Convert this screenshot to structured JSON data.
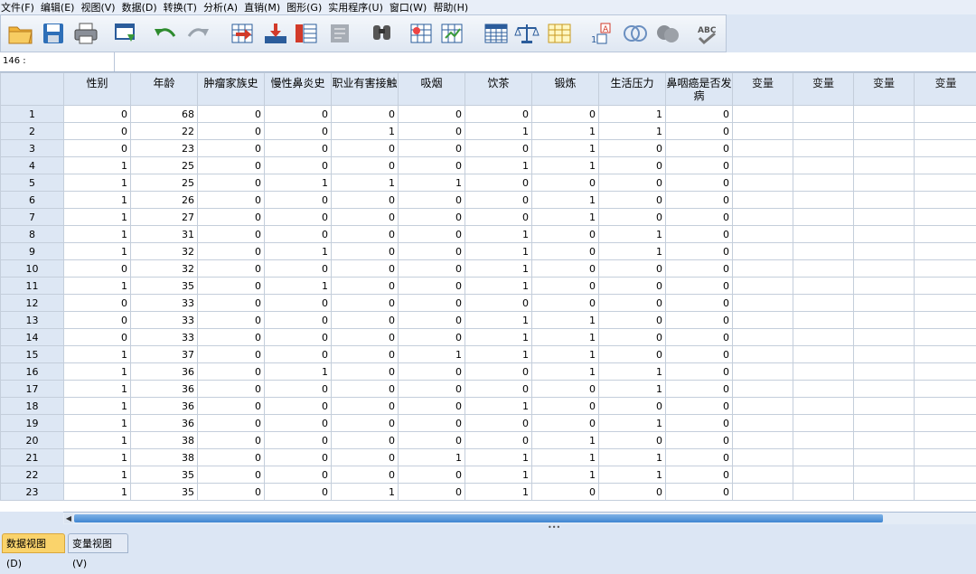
{
  "menu": [
    "文件(F)",
    "编辑(E)",
    "视图(V)",
    "数据(D)",
    "转换(T)",
    "分析(A)",
    "直销(M)",
    "图形(G)",
    "实用程序(U)",
    "窗口(W)",
    "帮助(H)"
  ],
  "toolbar_icons": [
    "open-folder-icon",
    "save-icon",
    "print-icon",
    "dialog-recall-icon",
    "undo-icon",
    "redo-icon",
    "goto-case-icon",
    "goto-variable-icon",
    "variables-icon",
    "run-descriptive-icon",
    "find-icon",
    "insert-cases-icon",
    "insert-variable-icon",
    "split-file-icon",
    "weight-cases-icon",
    "select-cases-icon",
    "value-labels-icon",
    "use-sets-icon",
    "show-all-variables-icon",
    "spell-check-icon"
  ],
  "cell_ref": "146 :",
  "columns": [
    "性别",
    "年龄",
    "肿瘤家族史",
    "慢性鼻炎史",
    "职业有害接触",
    "吸烟",
    "饮茶",
    "锻炼",
    "生活压力",
    "鼻咽癌是否发病"
  ],
  "empty_columns": [
    "变量",
    "变量",
    "变量",
    "变量"
  ],
  "rows": [
    [
      "1",
      "0",
      "68",
      "0",
      "0",
      "0",
      "0",
      "0",
      "0",
      "1",
      "0"
    ],
    [
      "2",
      "0",
      "22",
      "0",
      "0",
      "1",
      "0",
      "1",
      "1",
      "1",
      "0"
    ],
    [
      "3",
      "0",
      "23",
      "0",
      "0",
      "0",
      "0",
      "0",
      "1",
      "0",
      "0"
    ],
    [
      "4",
      "1",
      "25",
      "0",
      "0",
      "0",
      "0",
      "1",
      "1",
      "0",
      "0"
    ],
    [
      "5",
      "1",
      "25",
      "0",
      "1",
      "1",
      "1",
      "0",
      "0",
      "0",
      "0"
    ],
    [
      "6",
      "1",
      "26",
      "0",
      "0",
      "0",
      "0",
      "0",
      "1",
      "0",
      "0"
    ],
    [
      "7",
      "1",
      "27",
      "0",
      "0",
      "0",
      "0",
      "0",
      "1",
      "0",
      "0"
    ],
    [
      "8",
      "1",
      "31",
      "0",
      "0",
      "0",
      "0",
      "1",
      "0",
      "1",
      "0"
    ],
    [
      "9",
      "1",
      "32",
      "0",
      "1",
      "0",
      "0",
      "1",
      "0",
      "1",
      "0"
    ],
    [
      "10",
      "0",
      "32",
      "0",
      "0",
      "0",
      "0",
      "1",
      "0",
      "0",
      "0"
    ],
    [
      "11",
      "1",
      "35",
      "0",
      "1",
      "0",
      "0",
      "1",
      "0",
      "0",
      "0"
    ],
    [
      "12",
      "0",
      "33",
      "0",
      "0",
      "0",
      "0",
      "0",
      "0",
      "0",
      "0"
    ],
    [
      "13",
      "0",
      "33",
      "0",
      "0",
      "0",
      "0",
      "1",
      "1",
      "0",
      "0"
    ],
    [
      "14",
      "0",
      "33",
      "0",
      "0",
      "0",
      "0",
      "1",
      "1",
      "0",
      "0"
    ],
    [
      "15",
      "1",
      "37",
      "0",
      "0",
      "0",
      "1",
      "1",
      "1",
      "0",
      "0"
    ],
    [
      "16",
      "1",
      "36",
      "0",
      "1",
      "0",
      "0",
      "0",
      "1",
      "1",
      "0"
    ],
    [
      "17",
      "1",
      "36",
      "0",
      "0",
      "0",
      "0",
      "0",
      "0",
      "1",
      "0"
    ],
    [
      "18",
      "1",
      "36",
      "0",
      "0",
      "0",
      "0",
      "1",
      "0",
      "0",
      "0"
    ],
    [
      "19",
      "1",
      "36",
      "0",
      "0",
      "0",
      "0",
      "0",
      "0",
      "1",
      "0"
    ],
    [
      "20",
      "1",
      "38",
      "0",
      "0",
      "0",
      "0",
      "0",
      "1",
      "0",
      "0"
    ],
    [
      "21",
      "1",
      "38",
      "0",
      "0",
      "0",
      "1",
      "1",
      "1",
      "1",
      "0"
    ],
    [
      "22",
      "1",
      "35",
      "0",
      "0",
      "0",
      "0",
      "1",
      "1",
      "1",
      "0"
    ],
    [
      "23",
      "1",
      "35",
      "0",
      "0",
      "1",
      "0",
      "1",
      "0",
      "0",
      "0"
    ]
  ],
  "tabs": {
    "data_view": "数据视图(D)",
    "variable_view": "变量视图(V)"
  }
}
